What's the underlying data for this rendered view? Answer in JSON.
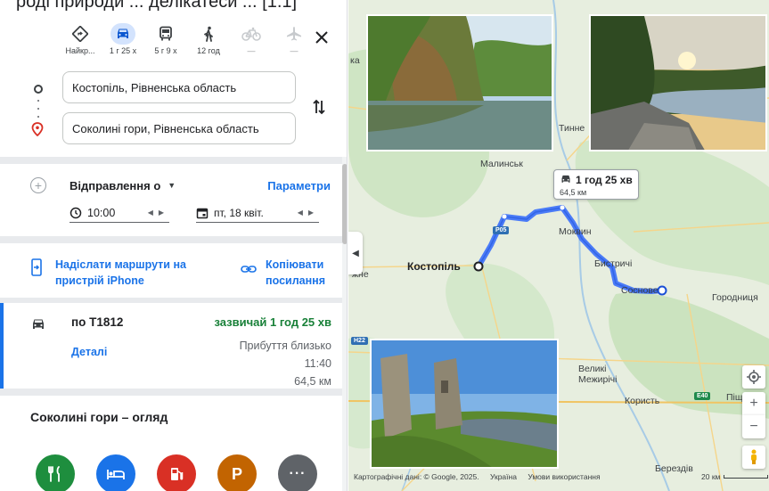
{
  "top_fragment": "роді природи ... делікатеси ... [1.1]",
  "travel_modes": [
    {
      "name": "best",
      "label": "Найкр...",
      "icon": "diamond-turn-icon",
      "active": false
    },
    {
      "name": "car",
      "label": "1 г 25 х",
      "icon": "car-icon",
      "active": true
    },
    {
      "name": "transit",
      "label": "5 г 9 х",
      "icon": "bus-icon",
      "active": false
    },
    {
      "name": "walk",
      "label": "12 год",
      "icon": "walk-icon",
      "active": false
    },
    {
      "name": "bike",
      "label": "—",
      "icon": "bike-icon",
      "active": false
    },
    {
      "name": "flight",
      "label": "—",
      "icon": "plane-icon",
      "active": false
    }
  ],
  "origin": "Костопіль, Рівненська область",
  "destination": "Соколині гори, Рівненська область",
  "departure": {
    "label": "Відправлення о",
    "params_label": "Параметри",
    "time": "10:00",
    "date": "пт, 18 квіт."
  },
  "share": {
    "send_label": "Надіслати маршрути на пристрій iPhone",
    "send_line1": "Надіслати маршрути на",
    "send_line2": "пристрій iPhone",
    "copy_line1": "Копіювати",
    "copy_line2": "посилання"
  },
  "route": {
    "name": "по Т1812",
    "usual": "зазвичай 1 год 25 хв",
    "arrival_label": "Прибуття близько",
    "arrival_time": "11:40",
    "distance": "64,5 км",
    "details": "Деталі"
  },
  "overview_title": "Соколині гори – огляд",
  "categories": [
    {
      "name": "restaurants",
      "icon": "fork-knife-icon",
      "color": "#1e8e3e"
    },
    {
      "name": "hotels",
      "icon": "bed-icon",
      "color": "#1a73e8"
    },
    {
      "name": "gas",
      "icon": "fuel-icon",
      "color": "#d93025"
    },
    {
      "name": "parking",
      "icon": "parking-icon",
      "color": "#c26401"
    },
    {
      "name": "more",
      "icon": "more-icon",
      "color": "#5f6368"
    }
  ],
  "map": {
    "route_box_duration": "1 год 25 хв",
    "route_box_distance": "64,5 км",
    "labels": {
      "tynne": "Тинне",
      "malynsk": "Малинськ",
      "kostopil": "Костопіль",
      "mokvyn": "Моквин",
      "bystrychi": "Бистричі",
      "sosnove": "Соснове",
      "horodnytsia": "Городниця",
      "velyki_mezhyrichi": "Великі Межирічі",
      "koryst": "Користь",
      "pishch": "Піщ",
      "berezdiv": "Берездів",
      "left_ka": "ка",
      "left_zhne": "жне",
      "shield_p05": "P05",
      "shield_h22": "H22",
      "shield_e40": "E40"
    },
    "attribution": "Картографічні дані: © Google, 2025.",
    "attr_ukraine": "Україна",
    "attr_terms": "Умови використання",
    "scale": "20 км"
  }
}
